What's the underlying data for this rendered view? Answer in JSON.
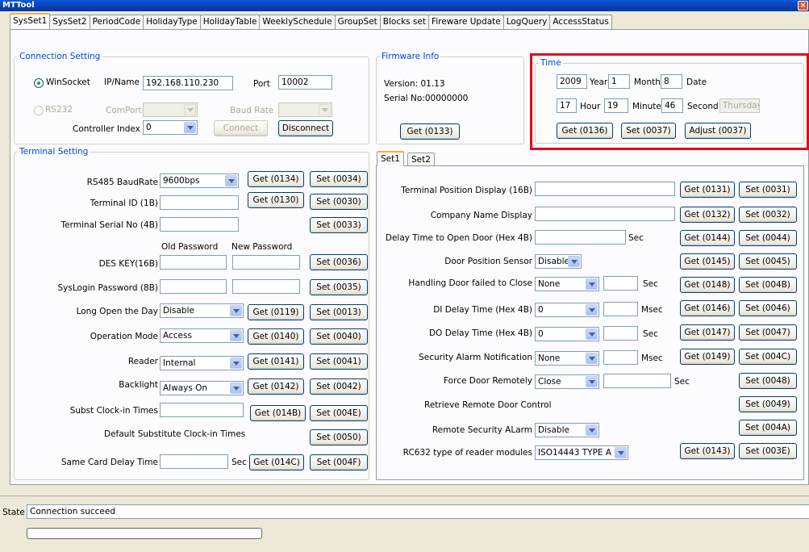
{
  "window": {
    "title": "MTTool",
    "close_glyph": "×"
  },
  "tabs": [
    "SysSet1",
    "SysSet2",
    "PeriodCode",
    "HolidayType",
    "HolidayTable",
    "WeeklySchedule",
    "GroupSet",
    "Blocks set",
    "Fireware Update",
    "LogQuery",
    "AccessStatus"
  ],
  "active_tab": "SysSet1",
  "connection": {
    "legend": "Connection Setting",
    "winsocket_label": "WinSocket",
    "ip_label": "IP/Name",
    "ip_value": "192.168.110.230",
    "port_label": "Port",
    "port_value": "10002",
    "rs232_label": "RS232",
    "comport_label": "ComPort",
    "baud_label": "Baud Rate",
    "controller_index_label": "Controller Index",
    "controller_index_value": "0",
    "connect_label": "Connect",
    "disconnect_label": "Disconnect"
  },
  "firmware": {
    "legend": "Firmware Info",
    "version_text": "Version:  01.13",
    "serial_text": "Serial No:00000000",
    "get_label": "Get (0133)"
  },
  "time": {
    "legend": "Time",
    "year_value": "2009",
    "year_label": "Year",
    "month_value": "1",
    "month_label": "Month",
    "date_value": "8",
    "date_label": "Date",
    "hour_value": "17",
    "hour_label": "Hour",
    "minute_value": "19",
    "minute_label": "Minute",
    "second_value": "46",
    "second_label": "Second",
    "weekday_value": "Thursday",
    "get_label": "Get (0136)",
    "set_label": "Set (0037)",
    "adjust_label": "Adjust (0037)"
  },
  "terminal": {
    "legend": "Terminal Setting",
    "rs485_label": "RS485 BaudRate",
    "rs485_value": "9600bps",
    "get_0134": "Get (0134)",
    "set_0034": "Set (0034)",
    "terminal_id_label": "Terminal ID (1B)",
    "get_0130": "Get (0130)",
    "set_0030": "Set (0030)",
    "serial_label": "Terminal Serial No (4B)",
    "set_0033": "Set (0033)",
    "old_password_label": "Old Password",
    "new_password_label": "New Password",
    "des_label": "DES KEY(16B)",
    "set_0036": "Set (0036)",
    "syslogin_label": "SysLogin Password (8B)",
    "set_0035": "Set (0035)",
    "long_open_label": "Long Open the Day",
    "long_open_value": "Disable",
    "get_0119": "Get (0119)",
    "set_0013": "Set (0013)",
    "op_mode_label": "Operation Mode",
    "op_mode_value": "Access",
    "get_0140": "Get (0140)",
    "set_0040": "Set (0040)",
    "reader_label": "Reader",
    "reader_value": "Internal",
    "get_0141": "Get (0141)",
    "set_0041": "Set (0041)",
    "backlight_label": "Backlight",
    "backlight_value": "Always On",
    "get_0142": "Get (0142)",
    "set_0042": "Set (0042)",
    "subst_label": "Subst Clock-in Times",
    "get_014b": "Get (014B)",
    "set_004e": "Set (004E)",
    "default_subst_label": "Default Substitute Clock-in Times",
    "set_0050": "Set (0050)",
    "same_card_label": "Same Card Delay Time",
    "same_card_unit": "Sec",
    "get_014c": "Get (014C)",
    "set_004f": "Set (004F)"
  },
  "set_tabs": [
    "Set1",
    "Set2"
  ],
  "set1": {
    "pos_display_label": "Terminal Position Display (16B)",
    "get_0131": "Get (0131)",
    "set_0031": "Set (0031)",
    "company_label": "Company Name Display",
    "get_0132": "Get (0132)",
    "set_0032": "Set (0032)",
    "delay_open_label": "Delay Time to Open Door (Hex 4B)",
    "delay_open_unit": "Sec",
    "get_0144": "Get (0144)",
    "set_0044": "Set (0044)",
    "door_sensor_label": "Door Position Sensor",
    "door_sensor_value": "Disable",
    "get_0145": "Get (0145)",
    "set_0045": "Set (0045)",
    "handling_label": "Handling Door failed to Close",
    "handling_value": "None",
    "handling_unit": "Sec",
    "get_0148": "Get (0148)",
    "set_004b": "Set (004B)",
    "di_label": "DI Delay Time (Hex 4B)",
    "di_value": "0",
    "di_unit": "Msec",
    "get_0146": "Get (0146)",
    "set_0046": "Set (0046)",
    "do_label": "DO Delay Time (Hex 4B)",
    "do_value": "0",
    "do_unit": "Sec",
    "get_0147": "Get (0147)",
    "set_0047": "Set (0047)",
    "alarm_label": "Security Alarm Notification",
    "alarm_value": "None",
    "alarm_unit": "Msec",
    "get_0149": "Get (0149)",
    "set_004c": "Set (004C)",
    "force_label": "Force Door Remotely",
    "force_value": "Close",
    "force_unit": "Sec",
    "set_0048": "Set (0048)",
    "retrieve_label": "Retrieve Remote Door Control",
    "set_0049": "Set (0049)",
    "remote_alarm_label": "Remote Security ALarm",
    "remote_alarm_value": "Disable",
    "set_004a": "Set (004A)",
    "rc632_label": "RC632 type of reader modules",
    "rc632_value": "ISO14443 TYPE A",
    "get_0143": "Get (0143)",
    "set_003e": "Set (003E)"
  },
  "status": {
    "label": "State",
    "value": "Connection succeed",
    "progress": 0
  },
  "colors": {
    "highlight": "#e4061a",
    "legend": "#0046d5",
    "titlebar": "#0a4fd0"
  }
}
